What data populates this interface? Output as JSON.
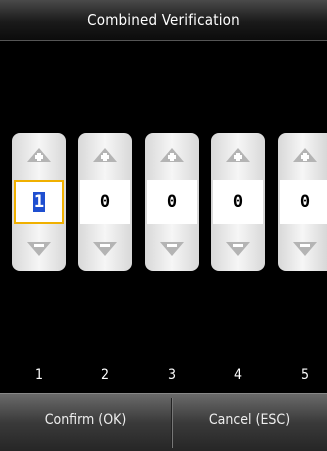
{
  "title": "Combined Verification",
  "digits": [
    {
      "index": "1",
      "value": "1",
      "active": true
    },
    {
      "index": "2",
      "value": "0",
      "active": false
    },
    {
      "index": "3",
      "value": "0",
      "active": false
    },
    {
      "index": "4",
      "value": "0",
      "active": false
    },
    {
      "index": "5",
      "value": "0",
      "active": false
    }
  ],
  "buttons": {
    "confirm": "Confirm (OK)",
    "cancel": "Cancel (ESC)"
  },
  "colors": {
    "focus_border": "#f0b000",
    "selection": "#1f4fd0"
  }
}
